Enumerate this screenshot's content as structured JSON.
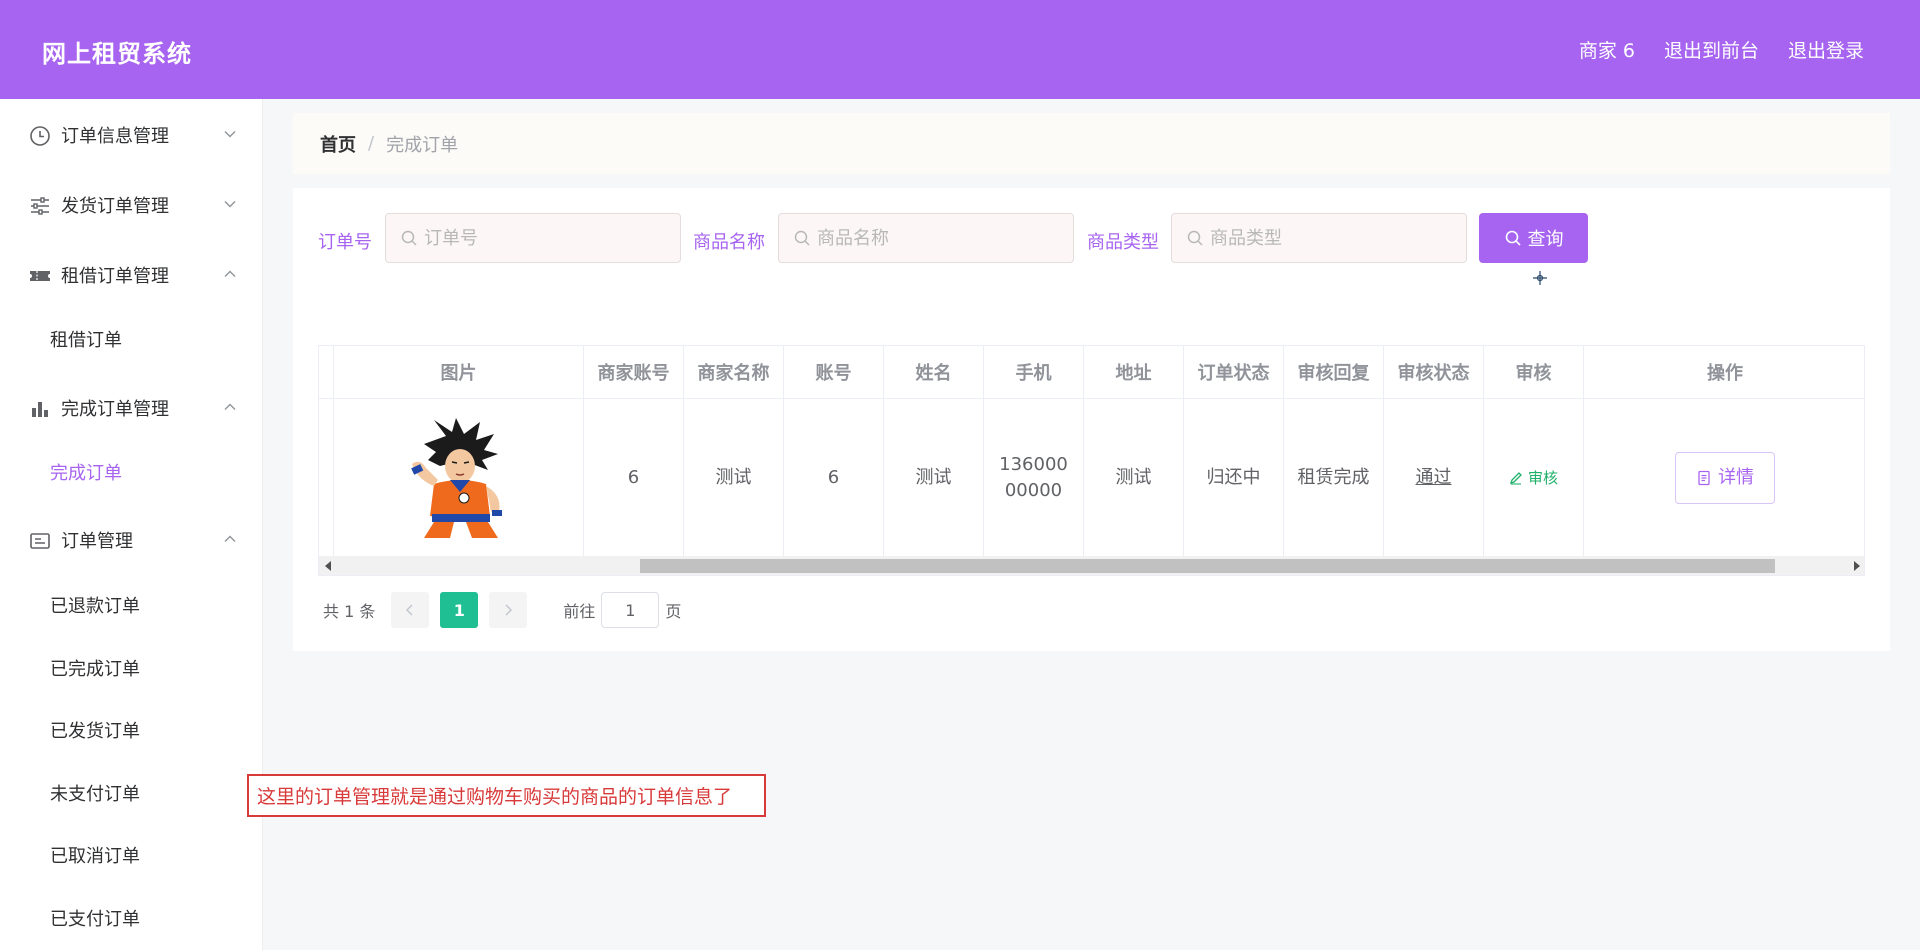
{
  "header": {
    "title": "网上租贸系统",
    "user": "商家 6",
    "to_front": "退出到前台",
    "logout": "退出登录",
    "bg_color": "#a764f0"
  },
  "sidebar": {
    "groups": [
      {
        "label": "订单信息管理",
        "icon": "clock-icon",
        "expanded": false
      },
      {
        "label": "发货订单管理",
        "icon": "sliders-icon",
        "expanded": false
      },
      {
        "label": "租借订单管理",
        "icon": "ticket-icon",
        "expanded": true,
        "items": [
          "租借订单"
        ]
      },
      {
        "label": "完成订单管理",
        "icon": "bar-chart-icon",
        "expanded": true,
        "items": [
          "完成订单"
        ]
      },
      {
        "label": "订单管理",
        "icon": "card-icon",
        "expanded": true,
        "items": [
          "已退款订单",
          "已完成订单",
          "已发货订单",
          "未支付订单",
          "已取消订单",
          "已支付订单"
        ]
      }
    ],
    "active_item": "完成订单"
  },
  "breadcrumb": {
    "home": "首页",
    "separator": "/",
    "current": "完成订单"
  },
  "search": {
    "order_no_label": "订单号",
    "order_no_placeholder": "订单号",
    "goods_name_label": "商品名称",
    "goods_name_placeholder": "商品名称",
    "goods_type_label": "商品类型",
    "goods_type_placeholder": "商品类型",
    "query_label": "查询"
  },
  "table": {
    "columns": [
      "图片",
      "商家账号",
      "商家名称",
      "账号",
      "姓名",
      "手机",
      "地址",
      "订单状态",
      "审核回复",
      "审核状态",
      "审核",
      "操作"
    ],
    "rows": [
      {
        "image": "goku-image",
        "merchant_account": "6",
        "merchant_name": "测试",
        "account": "6",
        "name": "测试",
        "phone": "13600000000",
        "address": "测试",
        "order_status": "归还中",
        "audit_reply": "租赁完成",
        "audit_status": "通过",
        "audit_action": "审核",
        "operation": "详情"
      }
    ]
  },
  "pagination": {
    "total": "共 1 条",
    "current_page": "1",
    "goto_label": "前往",
    "goto_value": "1",
    "page_suffix": "页"
  },
  "annotation": "这里的订单管理就是通过购物车购买的商品的订单信息了"
}
